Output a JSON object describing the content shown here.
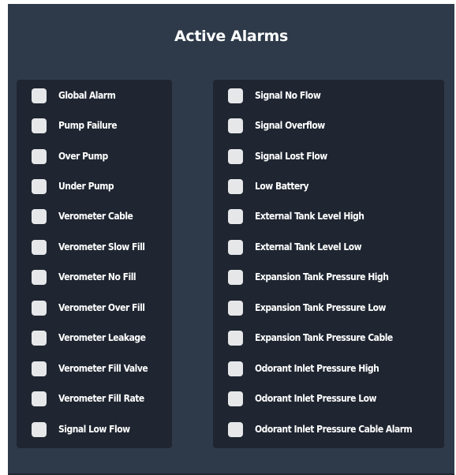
{
  "title": "Active Alarms",
  "left_alarms": [
    "Global Alarm",
    "Pump Failure",
    "Over Pump",
    "Under Pump",
    "Verometer Cable",
    "Verometer Slow Fill",
    "Verometer No Fill",
    "Verometer Over Fill",
    "Verometer Leakage",
    "Verometer Fill Valve",
    "Verometer Fill Rate",
    "Signal Low Flow"
  ],
  "right_alarms": [
    "Signal No Flow",
    "Signal Overflow",
    "Signal Lost Flow",
    "Low Battery",
    "External Tank Level High",
    "External Tank Level Low",
    "Expansion Tank Pressure High",
    "Expansion Tank Pressure Low",
    "Expansion Tank Pressure Cable",
    "Odorant Inlet Pressure High",
    "Odorant Inlet Pressure Low",
    "Odorant Inlet Pressure Cable Alarm"
  ]
}
